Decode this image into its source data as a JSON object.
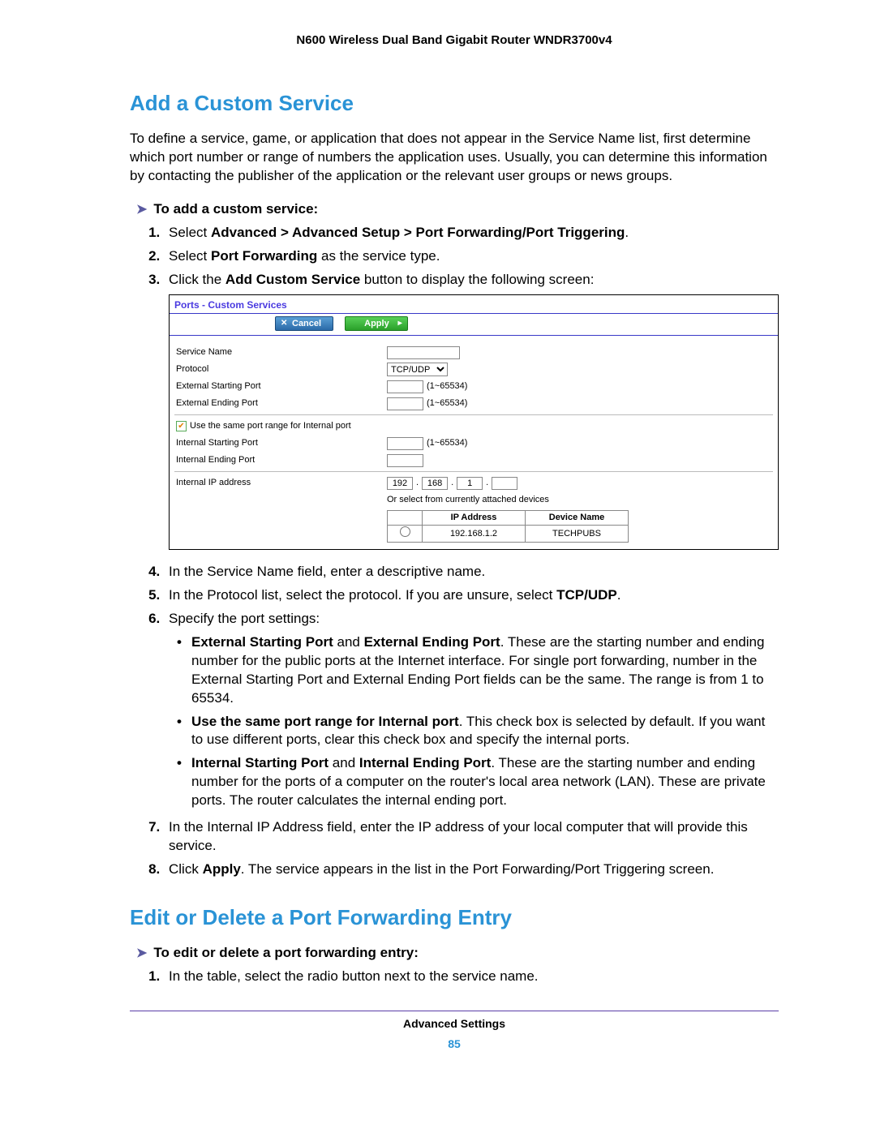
{
  "header": "N600 Wireless Dual Band Gigabit Router WNDR3700v4",
  "section1_title": "Add a Custom Service",
  "intro": "To define a service, game, or application that does not appear in the Service Name list, first determine which port number or range of numbers the application uses. Usually, you can determine this information by contacting the publisher of the application or the relevant user groups or news groups.",
  "proc1_title": "To add a custom service:",
  "step1_pre": "Select ",
  "step1_bold": "Advanced > Advanced Setup > Port Forwarding/Port Triggering",
  "step1_post": ".",
  "step2_pre": "Select ",
  "step2_bold": "Port Forwarding",
  "step2_post": " as the service type.",
  "step3_pre": "Click the ",
  "step3_bold": "Add Custom Service",
  "step3_post": " button to display the following screen:",
  "step4": "In the Service Name field, enter a descriptive name.",
  "step5_pre": "In the Protocol list, select the protocol. If you are unsure, select ",
  "step5_bold": "TCP/UDP",
  "step5_post": ".",
  "step6": "Specify the port settings:",
  "b1_t1": "External Starting Port",
  "b1_and": " and ",
  "b1_t2": "External Ending Port",
  "b1_rest": ". These are the starting number and ending number for the public ports at the Internet interface. For single port forwarding, number in the External Starting Port and External Ending Port fields can be the same. The range is from 1 to 65534.",
  "b2_t": "Use the same port range for Internal port",
  "b2_rest": ". This check box is selected by default. If you want to use different ports, clear this check box and specify the internal ports.",
  "b3_t1": "Internal Starting Port",
  "b3_t2": "Internal Ending Port",
  "b3_rest": ". These are the starting number and ending number for the ports of a computer on the router's local area network (LAN). These are private ports. The router calculates the internal ending port.",
  "step7": "In the Internal IP Address field, enter the IP address of your local computer that will provide this service.",
  "step8_pre": "Click ",
  "step8_bold": "Apply",
  "step8_post": ". The service appears in the list in the Port Forwarding/Port Triggering screen.",
  "section2_title": "Edit or Delete a Port Forwarding Entry",
  "proc2_title": "To edit or delete a port forwarding entry:",
  "p2_step1": "In the table, select the radio button next to the service name.",
  "footer_section": "Advanced Settings",
  "footer_page": "85",
  "shot": {
    "title": "Ports - Custom Services",
    "cancel": "Cancel",
    "apply": "Apply",
    "service_name": "Service Name",
    "protocol": "Protocol",
    "protocol_value": "TCP/UDP",
    "ext_start": "External Starting Port",
    "ext_end": "External Ending Port",
    "range": "(1~65534)",
    "same_port": "Use the same port range for Internal port",
    "int_start": "Internal Starting Port",
    "int_end": "Internal Ending Port",
    "int_ip": "Internal IP address",
    "ip": {
      "a": "192",
      "b": "168",
      "c": "1",
      "d": ""
    },
    "or_select": "Or select from currently attached devices",
    "th_ip": "IP Address",
    "th_dev": "Device Name",
    "row_ip": "192.168.1.2",
    "row_dev": "TECHPUBS"
  }
}
